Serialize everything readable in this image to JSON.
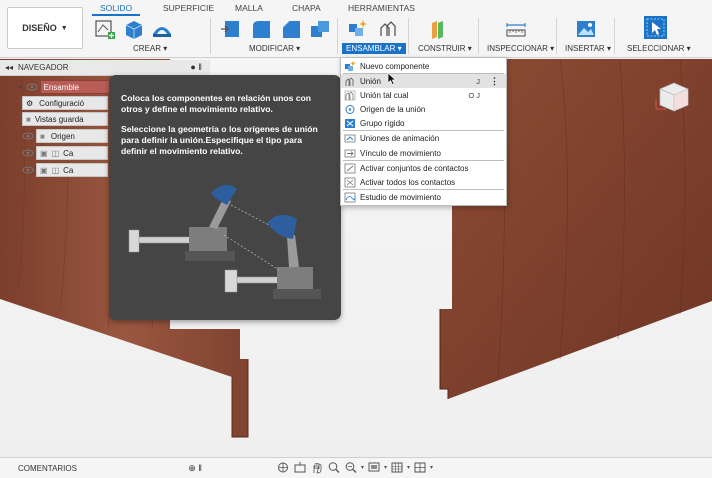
{
  "workspace": {
    "label": "DISEÑO"
  },
  "tabs": [
    {
      "label": "SOLIDO",
      "active": true
    },
    {
      "label": "SUPERFICIE",
      "active": false
    },
    {
      "label": "MALLA",
      "active": false
    },
    {
      "label": "CHAPA",
      "active": false
    },
    {
      "label": "HERRAMIENTAS",
      "active": false
    }
  ],
  "toolgroups": [
    {
      "label": "CREAR"
    },
    {
      "label": "MODIFICAR"
    },
    {
      "label": "ENSAMBLAR",
      "active": true
    },
    {
      "label": "CONSTRUIR"
    },
    {
      "label": "INSPECCIONAR"
    },
    {
      "label": "INSERTAR"
    },
    {
      "label": "SELECCIONAR"
    }
  ],
  "navigator": {
    "title": "NAVEGADOR",
    "items": [
      {
        "label": "Ensamble",
        "selected": true
      },
      {
        "label": "Configuració"
      },
      {
        "label": "Vistas guarda"
      },
      {
        "label": "Origen"
      },
      {
        "label": "Ca"
      },
      {
        "label": "Ca"
      }
    ]
  },
  "tooltip": {
    "line1": "Coloca los componentes en relación unos con otros y define el movimiento relativo.",
    "line2": "Seleccione la geometría o los orígenes de unión para definir la unión.Especifique el tipo para definir el movimiento relativo."
  },
  "menu": {
    "items": [
      {
        "label": "Nuevo componente",
        "shortcut": ""
      },
      {
        "label": "Unión",
        "shortcut": "J",
        "more": "⋮",
        "highlight": true
      },
      {
        "label": "Unión tal cual",
        "shortcut": "O J"
      },
      {
        "label": "Origen de la unión",
        "shortcut": ""
      },
      {
        "label": "Grupo rígido",
        "shortcut": ""
      },
      {
        "label": "Uniones de animación",
        "shortcut": ""
      },
      {
        "label": "Vínculo de movimiento",
        "shortcut": ""
      },
      {
        "label": "Activar conjuntos de contactos",
        "shortcut": ""
      },
      {
        "label": "Activar todos los contactos",
        "shortcut": ""
      },
      {
        "label": "Estudio de movimiento",
        "shortcut": ""
      }
    ]
  },
  "comments": {
    "title": "COMENTARIOS"
  },
  "colors": {
    "accent": "#1a73c6",
    "wood": "#8a4a36",
    "tooltip_bg": "#454545"
  }
}
